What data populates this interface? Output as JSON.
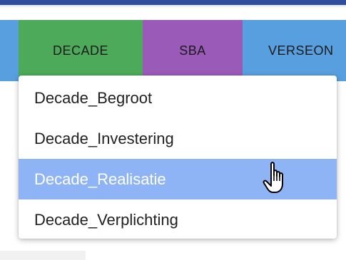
{
  "tabs": [
    {
      "label": "DECADE",
      "color": "#4caa5a"
    },
    {
      "label": "SBA",
      "color": "#9a5ab8"
    },
    {
      "label": "VERSEON",
      "color": "#579fde"
    }
  ],
  "dropdown": {
    "items": [
      {
        "label": "Decade_Begroot"
      },
      {
        "label": "Decade_Investering"
      },
      {
        "label": "Decade_Realisatie",
        "highlighted": true
      },
      {
        "label": "Decade_Verplichting"
      }
    ],
    "highlight_color": "#8fb4f5"
  },
  "cursor": {
    "icon": "hand-pointer-icon"
  },
  "colors": {
    "top_bar": "#2f4f9e",
    "tab_strip": "#579fde"
  }
}
